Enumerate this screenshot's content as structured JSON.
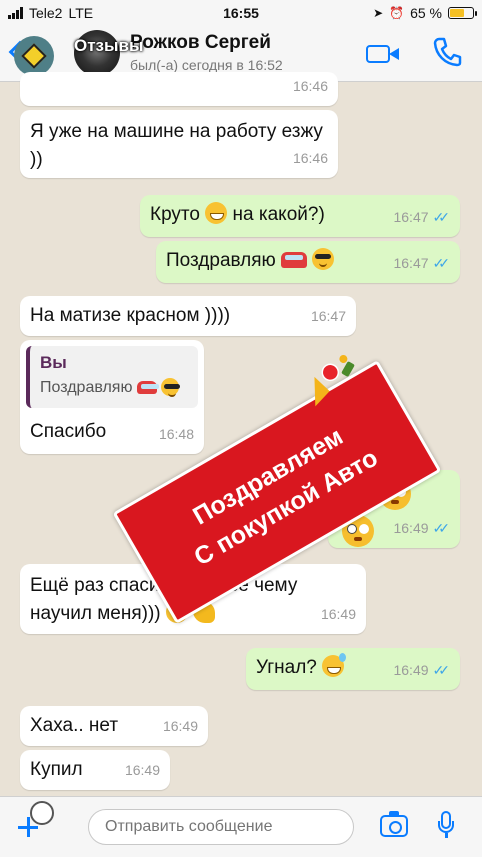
{
  "status_bar": {
    "carrier": "Tele2",
    "network": "LTE",
    "time": "16:55",
    "battery_text": "65 %",
    "battery_level": 0.65
  },
  "header": {
    "back_label": "Отзывы",
    "contact_name": "Рожков Сергей",
    "contact_status": "был(-а) сегодня в 16:52"
  },
  "messages": [
    {
      "direction": "in",
      "text": "",
      "time": "16:46"
    },
    {
      "direction": "in",
      "text": "Я уже на машине на работу езжу ))",
      "time": "16:46"
    },
    {
      "direction": "out",
      "text": "Круто",
      "text_after": "на какой?)",
      "time": "16:47",
      "emojis": [
        "grinning-face"
      ]
    },
    {
      "direction": "out",
      "text": "Поздравляю",
      "time": "16:47",
      "emojis": [
        "red-car",
        "sunglasses-face"
      ]
    },
    {
      "direction": "in",
      "text": "На матизе красном ))))",
      "time": "16:47"
    },
    {
      "direction": "in",
      "quote_author": "Вы",
      "quote_text": "Поздравляю",
      "text": "Спасибо",
      "time": "16:48",
      "emojis": [
        "red-car",
        "sunglasses-face"
      ]
    },
    {
      "direction": "out",
      "text": "",
      "time": "16:49",
      "emojis": [
        "flushed-face",
        "flushed-face",
        "flushed-face"
      ]
    },
    {
      "direction": "in",
      "text": "Ещё раз спасибо! За всё чему научил меня)))",
      "time": "16:49",
      "emojis": [
        "sunglasses-face",
        "flexed-biceps"
      ]
    },
    {
      "direction": "out",
      "text": "Угнал?",
      "time": "16:49",
      "emojis": [
        "sweat-smile-face"
      ]
    },
    {
      "direction": "in",
      "text": "Хаха.. нет",
      "time": "16:49"
    },
    {
      "direction": "in",
      "text": "Купил",
      "time": "16:49"
    }
  ],
  "promo": {
    "line1": "Поздравляем",
    "line2": "С покупкой Авто",
    "color": "#d9171f"
  },
  "input": {
    "placeholder": "Отправить сообщение"
  },
  "colors": {
    "accent": "#0a7cff",
    "outgoing_bubble": "#dcf8c6",
    "incoming_bubble": "#ffffff",
    "read_ticks": "#3ea6e8"
  }
}
